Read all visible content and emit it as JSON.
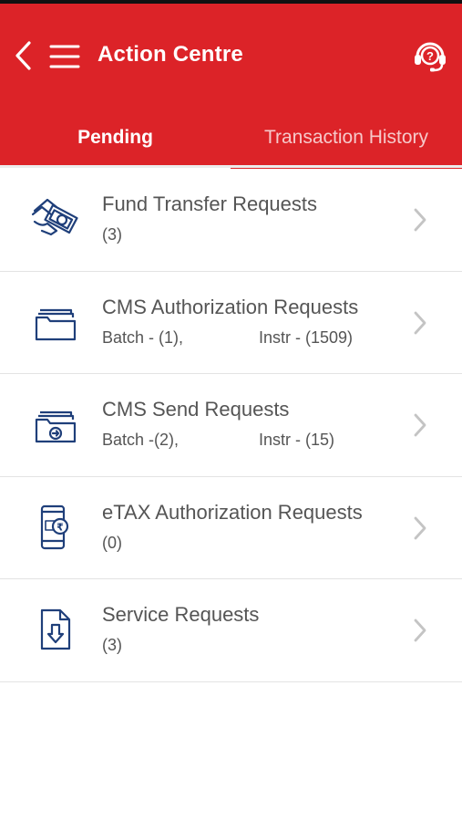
{
  "colors": {
    "brand_red": "#dc2328",
    "icon_blue": "#1f3f7a",
    "text_grey": "#555555"
  },
  "header": {
    "title": "Action Centre",
    "back_icon": "chevron-left-icon",
    "menu_icon": "hamburger-menu-icon",
    "help_icon": "headset-help-icon"
  },
  "tabs": [
    {
      "label": "Pending",
      "active": true
    },
    {
      "label": "Transaction History",
      "active": false
    }
  ],
  "items": [
    {
      "title": "Fund Transfer Requests",
      "sub": "(3)",
      "sub2": "",
      "icon": "fund-transfer-icon"
    },
    {
      "title": "CMS Authorization Requests",
      "sub": "Batch - (1),",
      "sub2": "Instr - (1509)",
      "icon": "folder-icon"
    },
    {
      "title": "CMS Send Requests",
      "sub": "Batch -(2),",
      "sub2": "Instr - (15)",
      "icon": "folder-send-icon"
    },
    {
      "title": "eTAX Authorization Requests",
      "sub": "(0)",
      "sub2": "",
      "icon": "mobile-tax-icon"
    },
    {
      "title": "Service Requests",
      "sub": "(3)",
      "sub2": "",
      "icon": "document-download-icon"
    }
  ]
}
